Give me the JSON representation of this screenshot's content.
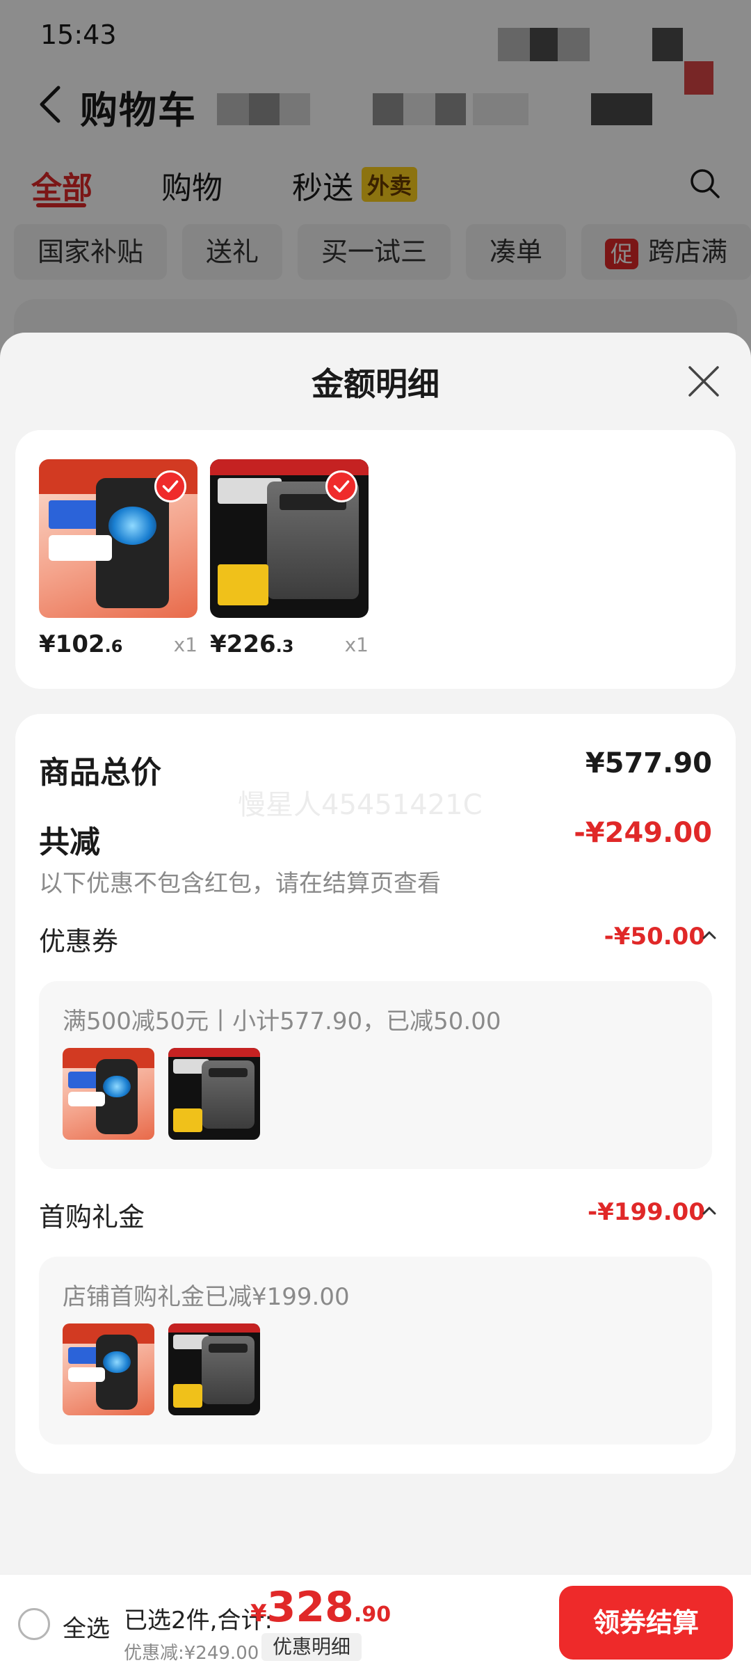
{
  "status_bar": {
    "time": "15:43"
  },
  "nav": {
    "title": "购物车"
  },
  "tabs": [
    {
      "label": "全部",
      "active": true
    },
    {
      "label": "购物",
      "active": false
    },
    {
      "label": "秒送",
      "active": false,
      "badge": "外卖"
    }
  ],
  "chips": [
    {
      "label": "国家补贴"
    },
    {
      "label": "送礼"
    },
    {
      "label": "买一试三"
    },
    {
      "label": "凑单"
    },
    {
      "label": "跨店满",
      "promo": "促"
    }
  ],
  "sheet": {
    "title": "金额明细",
    "products": [
      {
        "price_int": "¥102",
        "price_dec": ".6",
        "qty": "x1",
        "icon": "trash-bin-product-image"
      },
      {
        "price_int": "¥226",
        "price_dec": ".3",
        "qty": "x1",
        "icon": "washing-machine-product-image"
      }
    ],
    "total": {
      "label": "商品总价",
      "value": "¥577.90"
    },
    "discount": {
      "label": "共减",
      "value": "-¥249.00",
      "note": "以下优惠不包含红包，请在结算页查看"
    },
    "watermark": "慢星人45451421C",
    "coupon": {
      "label": "优惠券",
      "value": "-¥50.00",
      "desc": "满500减50元丨小计577.90，已减50.00"
    },
    "first_gift": {
      "label": "首购礼金",
      "value": "-¥199.00",
      "desc": "店铺首购礼金已减¥199.00"
    }
  },
  "bottom_bar": {
    "select_all": "全选",
    "selected_count": "已选2件,合计:",
    "total_currency": "¥",
    "total_int": "328",
    "total_dec": ".90",
    "discount_line": "优惠减:¥249.00",
    "detail_chip": "优惠明细",
    "checkout": "领券结算"
  },
  "colors": {
    "accent": "#e02828",
    "button": "#ee2a2a",
    "badge_yellow": "#ffd21e"
  }
}
